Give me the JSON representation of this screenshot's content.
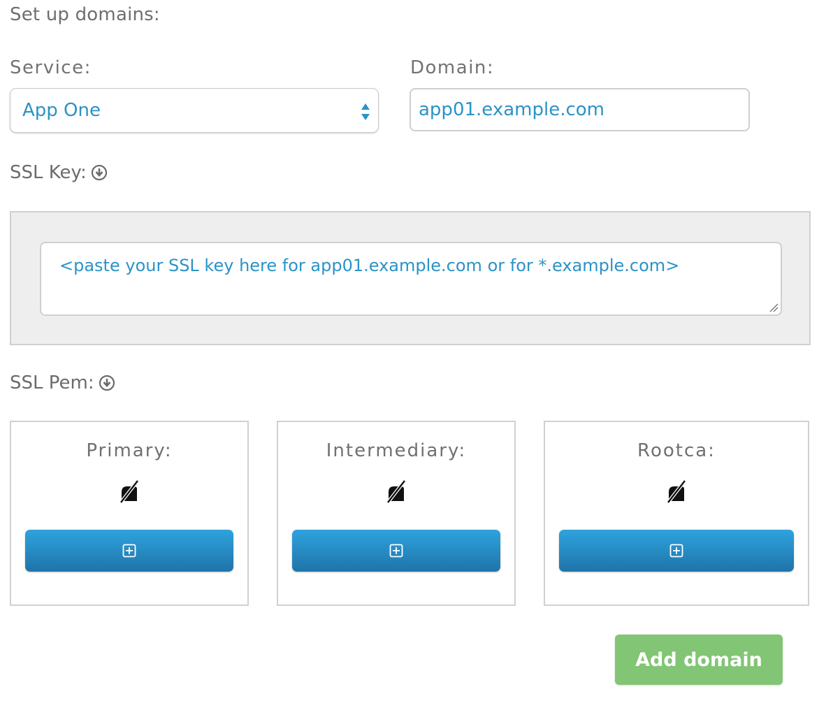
{
  "heading": "Set up domains:",
  "service": {
    "label": "Service:",
    "selected": "App One"
  },
  "domain": {
    "label": "Domain:",
    "value": "app01.example.com"
  },
  "ssl_key": {
    "label": "SSL Key:",
    "icon": "download-circle-icon",
    "placeholder": "<paste your SSL key here for app01.example.com or for *.example.com>"
  },
  "ssl_pem": {
    "label": "SSL Pem:",
    "icon": "download-circle-icon",
    "cards": [
      {
        "title": "Primary:",
        "status_icon": "no-file-icon",
        "button_icon": "plus-square-icon"
      },
      {
        "title": "Intermediary:",
        "status_icon": "no-file-icon",
        "button_icon": "plus-square-icon"
      },
      {
        "title": "Rootca:",
        "status_icon": "no-file-icon",
        "button_icon": "plus-square-icon"
      }
    ]
  },
  "add_domain_label": "Add domain",
  "colors": {
    "link_blue": "#2b93c6",
    "button_blue_top": "#2ea3de",
    "button_blue_bottom": "#1f74a9",
    "add_green": "#82c574",
    "panel_gray": "#eeeeee"
  }
}
